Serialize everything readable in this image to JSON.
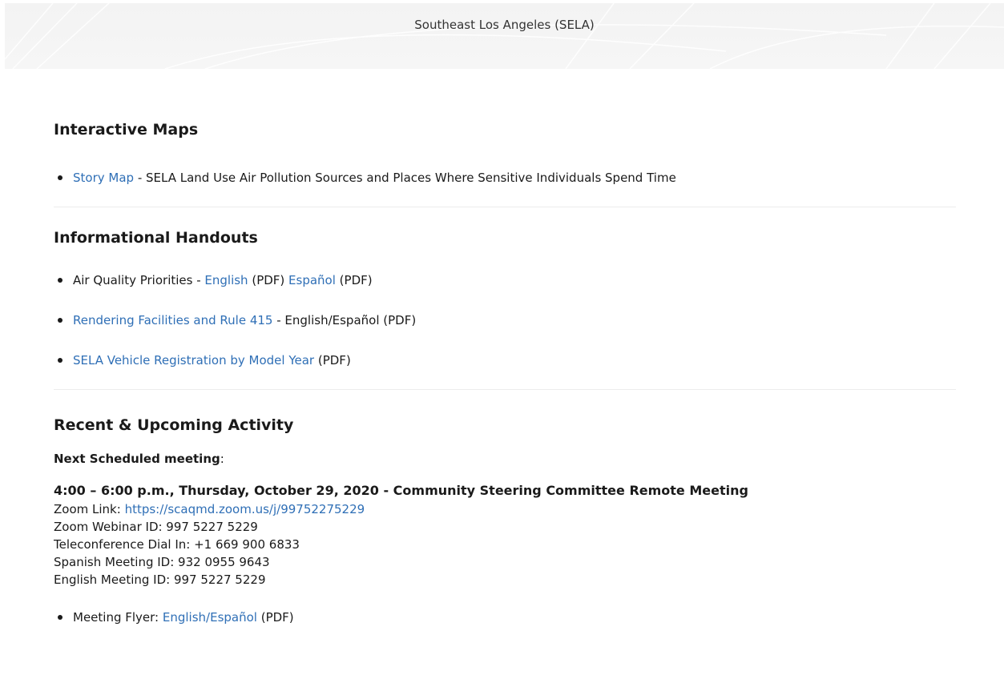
{
  "banner": {
    "title": "Southeast Los Angeles (SELA)"
  },
  "interactive_maps": {
    "heading": "Interactive Maps",
    "items": [
      {
        "link": "Story Map",
        "text": " - SELA Land Use Air Pollution Sources and Places Where Sensitive Individuals Spend Time"
      }
    ]
  },
  "handouts": {
    "heading": "Informational Handouts",
    "item1": {
      "prefix": "Air Quality Priorities  - ",
      "link_english": "English",
      "mid": " (PDF)  ",
      "link_espanol": "Español",
      "suffix": " (PDF)"
    },
    "item2": {
      "link": "Rendering Facilities and Rule 415",
      "text": " - English/Español (PDF)"
    },
    "item3": {
      "link": "SELA Vehicle Registration by Model Year",
      "text": " (PDF)"
    }
  },
  "activity": {
    "heading": "Recent & Upcoming Activity",
    "next_label": "Next Scheduled meeting",
    "next_colon": ":",
    "meeting_title": "4:00 – 6:00 p.m., Thursday, October 29, 2020 - Community Steering Committee Remote Meeting",
    "zoom_label": "Zoom Link: ",
    "zoom_link": "https://scaqmd.zoom.us/j/99752275229",
    "webinar_id": "Zoom Webinar ID: 997 5227 5229",
    "dial_in": "Teleconference Dial In: +1 669 900 6833",
    "spanish_id": "Spanish Meeting ID: 932 0955 9643",
    "english_id": "English Meeting ID: 997 5227 5229",
    "flyer": {
      "prefix": "Meeting Flyer: ",
      "link": "English/Español",
      "suffix": " (PDF)"
    }
  }
}
